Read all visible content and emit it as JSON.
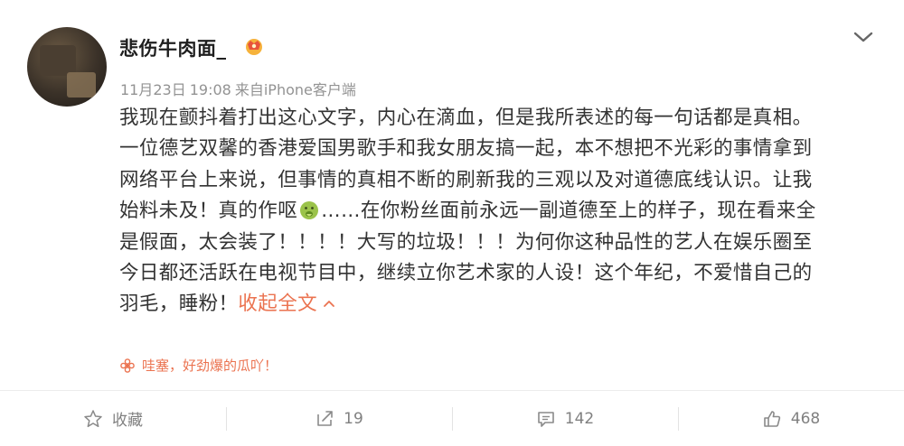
{
  "post": {
    "username": "悲伤牛肉面_",
    "date": "11月23日",
    "time": "19:08",
    "source": "来自iPhone客户端",
    "content_lines": [
      "我现在颤抖着打出这心文字，内心在滴血，但是我所表述的每一句话都是真相。",
      "一位德艺双馨的香港爱国男歌手和我女朋友搞一起，本不想把不光彩的事情拿到",
      "网络平台上来说，但事情的真相不断的刷新我的三观以及对道德底线认识。让我",
      "始料未及！真的作呕",
      "……在你粉丝面前永远一副道德至上的样子，现在看来全",
      "是假面，太会装了！！！！大写的垃圾！！！为何你这种品性的艺人在娱乐圈至",
      "今日都还活跃在电视节目中，继续立你艺术家的人设！这个年纪，不爱惜自己的",
      "羽毛，睡粉！"
    ],
    "emoji_name": "vomit-emoji",
    "collapse_label": "收起全文",
    "source_tag": "哇塞，好劲爆的瓜吖！"
  },
  "actions": {
    "favorite_label": "收藏",
    "repost_count": "19",
    "comment_count": "142",
    "like_count": "468"
  },
  "colors": {
    "accent": "#eb7350",
    "meta_gray": "#939393",
    "text": "#333333"
  }
}
